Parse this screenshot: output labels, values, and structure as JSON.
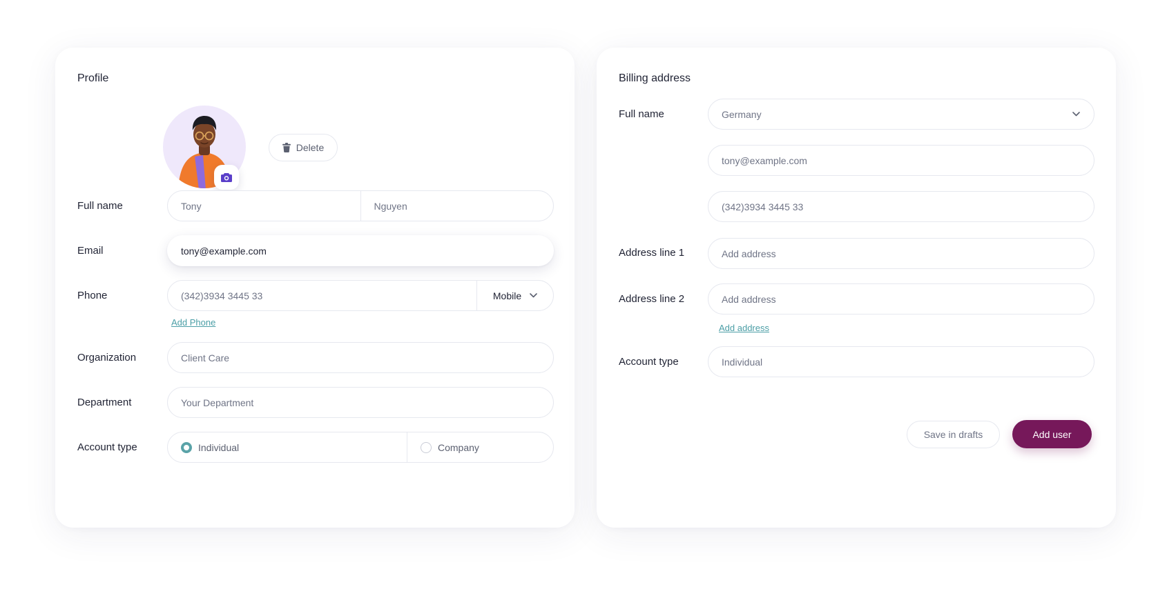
{
  "profile": {
    "title": "Profile",
    "delete_label": "Delete",
    "full_name": {
      "label": "Full name",
      "first_placeholder": "Tony",
      "last_placeholder": "Nguyen"
    },
    "email": {
      "label": "Email",
      "value": "tony@example.com"
    },
    "phone": {
      "label": "Phone",
      "placeholder": "(342)3934 3445 33",
      "type_value": "Mobile",
      "add_link": "Add Phone"
    },
    "organization": {
      "label": "Organization",
      "placeholder": "Client Care"
    },
    "department": {
      "label": "Department",
      "placeholder": "Your Department"
    },
    "account_type": {
      "label": "Account type",
      "options": [
        "Individual",
        "Company"
      ],
      "selected": "Individual"
    }
  },
  "billing": {
    "title": "Billing address",
    "full_name": {
      "label": "Full name",
      "country_value": "Germany"
    },
    "email_placeholder": "tony@example.com",
    "phone_placeholder": "(342)3934 3445 33",
    "address_line_1": {
      "label": "Address line 1",
      "placeholder": "Add address"
    },
    "address_line_2": {
      "label": "Address line 2",
      "placeholder": "Add address"
    },
    "add_address_link": "Add address",
    "account_type": {
      "label": "Account type",
      "placeholder": "Individual"
    },
    "save_drafts_label": "Save in drafts",
    "add_user_label": "Add user"
  },
  "colors": {
    "accent_teal": "#5aa3a8",
    "primary_button": "#76185a",
    "avatar_bg": "#efe8fb",
    "camera_icon": "#5a3fc9"
  },
  "icons": [
    "trash-icon",
    "camera-icon",
    "chevron-down-icon"
  ]
}
